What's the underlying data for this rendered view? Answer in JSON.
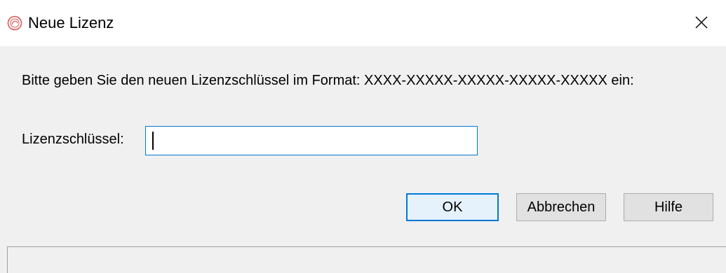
{
  "dialog": {
    "title": "Neue Lizenz",
    "close_symbol": "✕",
    "instruction": "Bitte geben Sie den neuen Lizenzschlüssel im Format: XXXX-XXXXX-XXXXX-XXXXX-XXXXX ein:",
    "key_label": "Lizenzschlüssel:",
    "key_value": "",
    "buttons": {
      "ok": "OK",
      "cancel": "Abbrechen",
      "help": "Hilfe"
    },
    "status_text": ""
  },
  "icons": {
    "app": "app-logo-icon",
    "close": "close-icon"
  },
  "colors": {
    "focus_border": "#0078d7",
    "dialog_bg": "#f0f0f0",
    "titlebar_bg": "#ffffff"
  }
}
